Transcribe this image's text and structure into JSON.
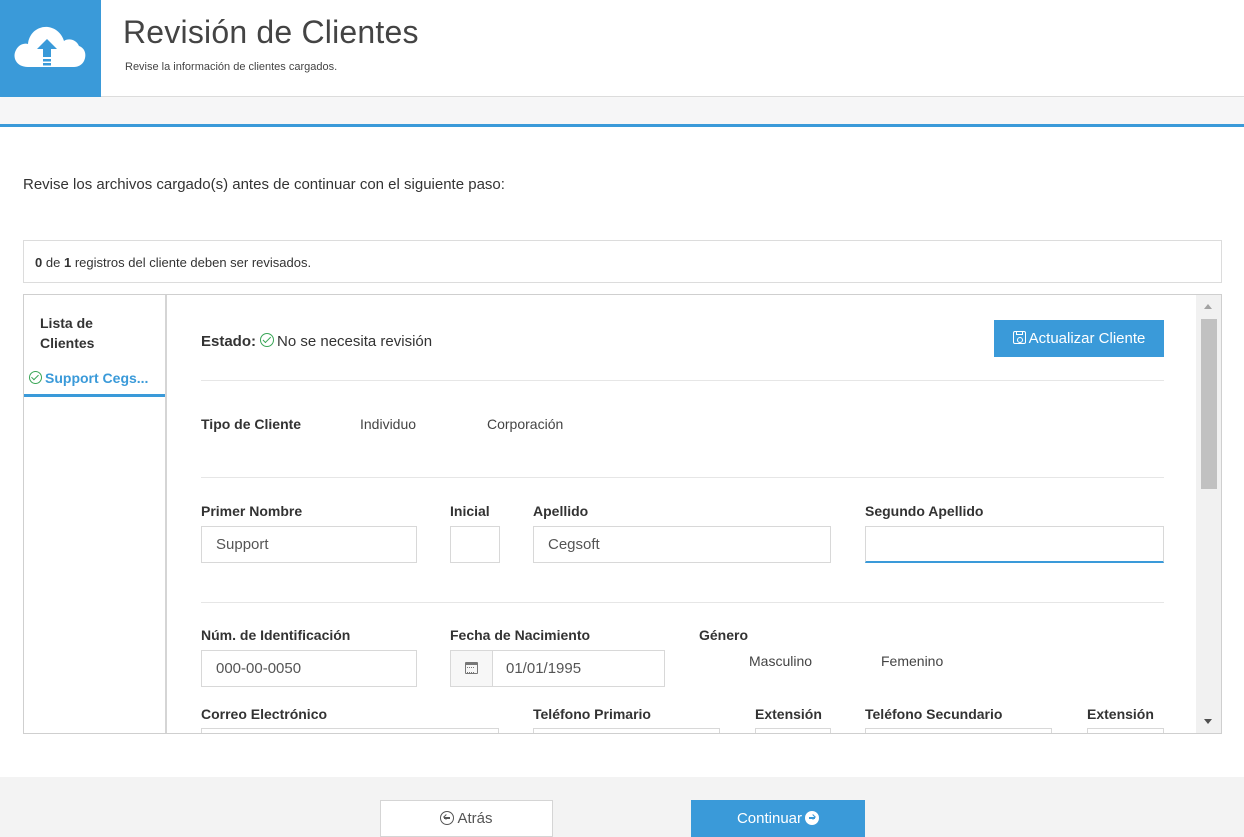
{
  "header": {
    "title": "Revisión de Clientes",
    "subtitle": "Revise la información de clientes cargados.",
    "logo_icon": "cloud-upload-icon",
    "accent_color": "#3a9ad9"
  },
  "instructions": "Revise los archivos cargado(s) antes de continuar con el siguiente paso:",
  "review_count": {
    "reviewed": "0",
    "connector": "de",
    "total": "1",
    "suffix": "registros del cliente deben ser revisados."
  },
  "sidebar": {
    "heading": "Lista de Clientes",
    "items": [
      {
        "label": "Support Cegs...",
        "icon": "check-circle-icon"
      }
    ]
  },
  "status": {
    "label": "Estado:",
    "value": "No se necesita revisión",
    "icon": "check-circle-icon"
  },
  "update_button": {
    "label": "Actualizar Cliente",
    "icon": "save-icon"
  },
  "client_type": {
    "label": "Tipo de Cliente",
    "options": [
      "Individuo",
      "Corporación"
    ]
  },
  "name_fields": {
    "first_name": {
      "label": "Primer Nombre",
      "value": "Support"
    },
    "initial": {
      "label": "Inicial",
      "value": ""
    },
    "last_name": {
      "label": "Apellido",
      "value": "Cegsoft"
    },
    "second_last_name": {
      "label": "Segundo Apellido",
      "value": ""
    }
  },
  "id_fields": {
    "id_number": {
      "label": "Núm. de Identificación",
      "value": "000-00-0050"
    },
    "birth_date": {
      "label": "Fecha de Nacimiento",
      "value": "01/01/1995",
      "icon": "calendar-icon"
    },
    "gender": {
      "label": "Género",
      "options": [
        "Masculino",
        "Femenino"
      ]
    }
  },
  "contact_fields": {
    "email": {
      "label": "Correo Electrónico"
    },
    "primary_phone": {
      "label": "Teléfono Primario"
    },
    "primary_ext": {
      "label": "Extensión"
    },
    "secondary_phone": {
      "label": "Teléfono Secundario"
    },
    "secondary_ext": {
      "label": "Extensión"
    }
  },
  "footer": {
    "back_label": "Atrás",
    "continue_label": "Continuar"
  }
}
